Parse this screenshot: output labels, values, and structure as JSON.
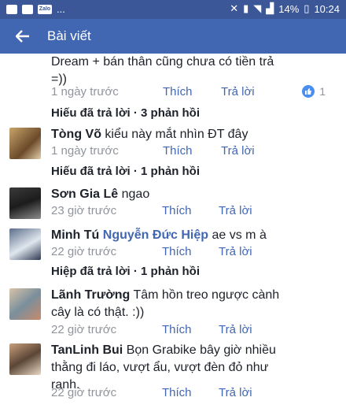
{
  "status_bar": {
    "battery": "14%",
    "time": "10:24",
    "zalo": "Zalo",
    "more": "..."
  },
  "header": {
    "title": "Bài viết"
  },
  "top_partial": {
    "line1": "Dream + bán thân cũng chưa có tiền trả",
    "line2": "=))",
    "time": "1 ngày trước",
    "like": "Thích",
    "reply": "Trả lời",
    "like_count": "1",
    "replies_summary": "Hiếu đã trả lời  ·  3 phản hồi"
  },
  "comments": [
    {
      "name": "Tòng Võ",
      "text": " kiểu này mắt nhìn ĐT đây",
      "time": "1 ngày trước",
      "like": "Thích",
      "reply": "Trả lời",
      "replies_summary": "Hiếu đã trả lời  ·  1 phản hồi"
    },
    {
      "name": "Sơn Gia Lê",
      "text": " ngao",
      "time": "23 giờ trước",
      "like": "Thích",
      "reply": "Trả lời"
    },
    {
      "name": "Minh Tú",
      "tag": "Nguyễn Đức Hiệp",
      "text": " ae vs m à",
      "time": "22 giờ trước",
      "like": "Thích",
      "reply": "Trả lời",
      "replies_summary": "Hiệp đã trả lời  ·  1 phản hồi"
    },
    {
      "name": "Lãnh Trường",
      "text1": " Tâm hồn treo ngược cành",
      "text2": "cây là có thật. :))",
      "time": "22 giờ trước",
      "like": "Thích",
      "reply": "Trả lời"
    },
    {
      "name": "TanLinh Bui",
      "text1": " Bọn Grabike bây giờ nhiều",
      "text2": "thằng đi láo, vượt ẩu, vượt đèn đỏ như",
      "text3": "ranh.",
      "time": "22 giờ trước",
      "like": "Thích",
      "reply": "Trả lời"
    }
  ],
  "colors": {
    "brand": "#4267b2",
    "statusbar": "#3b5798",
    "meta": "#90949c",
    "text": "#1d2129"
  }
}
